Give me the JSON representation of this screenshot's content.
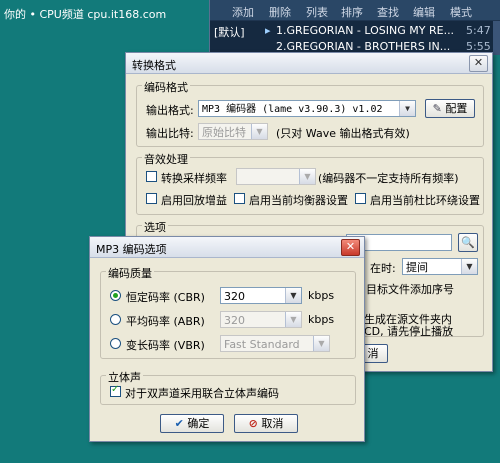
{
  "watermark": "你的 • CPU频道 cpu.it168.com",
  "player": {
    "menu": [
      "添加",
      "删除",
      "列表",
      "排序",
      "查找",
      "编辑",
      "模式"
    ],
    "rows": [
      {
        "prefix": "[默认]",
        "text": "1.GREGORIAN - LOSING MY RE...",
        "time": "5:47"
      },
      {
        "prefix": "",
        "text": "2.GREGORIAN - BROTHERS IN...",
        "time": "5:55"
      }
    ]
  },
  "convert_dialog": {
    "title": "转换格式",
    "encode_group": "编码格式",
    "output_format_label": "输出格式:",
    "output_format_value": "MP3 编码器 (lame v3.90.3) v1.02",
    "config_button": "配置",
    "bitrate_label": "输出比特:",
    "bitrate_value": "原始比特",
    "bitrate_note": "(只对 Wave 输出格式有效)",
    "effects_group": "音效处理",
    "resample_label": "转换采样频率",
    "resample_note": "(编码器不一定支持所有频率)",
    "replay_gain": "启用回放增益",
    "use_eq": "启用当前均衡器设置",
    "use_surround": "启用当前杜比环绕设置",
    "options_group": "选项",
    "partial_time": "在时:",
    "time_value": "提间",
    "partial_add": "目标文件添加序号",
    "partial_src1": "生成在源文件夹内",
    "partial_src2": "CD, 请先停止播放",
    "partial_cancel": "消"
  },
  "mp3_dialog": {
    "title": "MP3 编码选项",
    "quality_group": "编码质量",
    "cbr_label": "恒定码率 (CBR)",
    "cbr_value": "320",
    "abr_label": "平均码率 (ABR)",
    "abr_value": "320",
    "vbr_label": "变长码率 (VBR)",
    "vbr_value": "Fast Standard",
    "unit": "kbps",
    "stereo_group": "立体声",
    "joint_stereo": "对于双声道采用联合立体声编码",
    "ok": "确定",
    "cancel": "取消"
  }
}
